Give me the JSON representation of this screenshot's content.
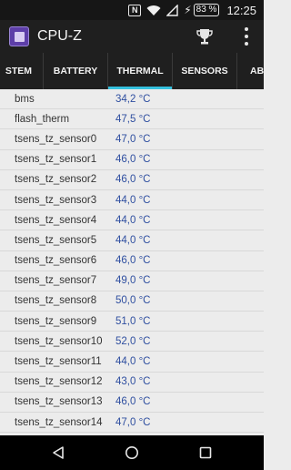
{
  "status_bar": {
    "battery_percent": "83 %",
    "time": "12:25"
  },
  "app_bar": {
    "title": "CPU-Z"
  },
  "tabs": [
    "STEM",
    "BATTERY",
    "THERMAL",
    "SENSORS",
    "ABO"
  ],
  "active_tab": "THERMAL",
  "sensors": [
    {
      "name": "bms",
      "value": "34,2 °C"
    },
    {
      "name": "flash_therm",
      "value": "47,5 °C"
    },
    {
      "name": "tsens_tz_sensor0",
      "value": "47,0 °C"
    },
    {
      "name": "tsens_tz_sensor1",
      "value": "46,0 °C"
    },
    {
      "name": "tsens_tz_sensor2",
      "value": "46,0 °C"
    },
    {
      "name": "tsens_tz_sensor3",
      "value": "44,0 °C"
    },
    {
      "name": "tsens_tz_sensor4",
      "value": "44,0 °C"
    },
    {
      "name": "tsens_tz_sensor5",
      "value": "44,0 °C"
    },
    {
      "name": "tsens_tz_sensor6",
      "value": "46,0 °C"
    },
    {
      "name": "tsens_tz_sensor7",
      "value": "49,0 °C"
    },
    {
      "name": "tsens_tz_sensor8",
      "value": "50,0 °C"
    },
    {
      "name": "tsens_tz_sensor9",
      "value": "51,0 °C"
    },
    {
      "name": "tsens_tz_sensor10",
      "value": "52,0 °C"
    },
    {
      "name": "tsens_tz_sensor11",
      "value": "44,0 °C"
    },
    {
      "name": "tsens_tz_sensor12",
      "value": "43,0 °C"
    },
    {
      "name": "tsens_tz_sensor13",
      "value": "46,0 °C"
    },
    {
      "name": "tsens_tz_sensor14",
      "value": "47,0 °C"
    }
  ],
  "colors": {
    "accent": "#35c0de",
    "value_text": "#2f4fa0",
    "toolbar": "#1f1f1f"
  },
  "icons": {
    "status": [
      "nfc-icon",
      "wifi-icon",
      "cellular-icon",
      "battery-charging-icon"
    ],
    "app_bar": [
      "cpu-z-logo-icon",
      "trophy-icon",
      "more-vert-icon"
    ],
    "nav": [
      "back-icon",
      "home-icon",
      "recents-icon"
    ]
  }
}
